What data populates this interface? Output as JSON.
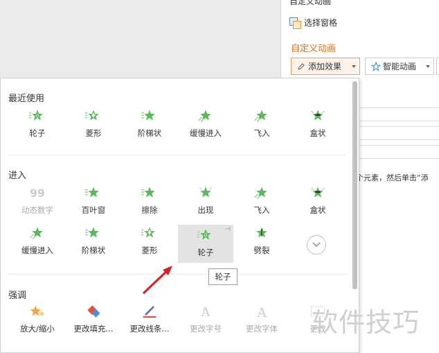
{
  "task_pane": {
    "title": "自定义动画",
    "select_pane": "选择窗格",
    "section": "自定义动画",
    "add_effect": "添加效果",
    "smart_animation": "智能动画",
    "hint": "个元素，然后单击“添"
  },
  "popup": {
    "recent_title": "最近使用",
    "recent": [
      {
        "label": "轮子",
        "icon": "wheel-effect-icon"
      },
      {
        "label": "菱形",
        "icon": "diamond-effect-icon"
      },
      {
        "label": "阶梯状",
        "icon": "stairs-effect-icon"
      },
      {
        "label": "缓慢进入",
        "icon": "crawl-in-effect-icon"
      },
      {
        "label": "飞入",
        "icon": "fly-in-effect-icon"
      },
      {
        "label": "盒状",
        "icon": "box-effect-icon"
      }
    ],
    "enter_title": "进入",
    "enter_row1": [
      {
        "label": "动态数字",
        "icon": "dynamic-number-icon",
        "disabled": true
      },
      {
        "label": "百叶窗",
        "icon": "blinds-effect-icon"
      },
      {
        "label": "擦除",
        "icon": "wipe-effect-icon"
      },
      {
        "label": "出现",
        "icon": "appear-effect-icon"
      },
      {
        "label": "飞入",
        "icon": "fly-in-effect-icon"
      },
      {
        "label": "盒状",
        "icon": "box-effect-icon"
      }
    ],
    "enter_row2": [
      {
        "label": "缓慢进入",
        "icon": "crawl-in-effect-icon"
      },
      {
        "label": "阶梯状",
        "icon": "stairs-effect-icon"
      },
      {
        "label": "菱形",
        "icon": "diamond-effect-icon"
      },
      {
        "label": "轮子",
        "icon": "wheel-effect-icon",
        "selected": true
      },
      {
        "label": "劈裂",
        "icon": "split-effect-icon"
      }
    ],
    "emphasis_title": "强调",
    "emphasis": [
      {
        "label": "放大/缩小",
        "icon": "grow-shrink-icon"
      },
      {
        "label": "更改填充...",
        "icon": "change-fill-icon"
      },
      {
        "label": "更改线条...",
        "icon": "change-line-icon"
      },
      {
        "label": "更改字号",
        "icon": "change-font-size-icon",
        "disabled": true
      },
      {
        "label": "更改字体",
        "icon": "change-font-icon",
        "disabled": true
      },
      {
        "label": "更改",
        "icon": "change-style-icon",
        "disabled": true
      }
    ],
    "tooltip": "轮子"
  },
  "watermark": "软件技巧",
  "colors": {
    "accent": "#e06c16",
    "star": "#5cb85c"
  }
}
